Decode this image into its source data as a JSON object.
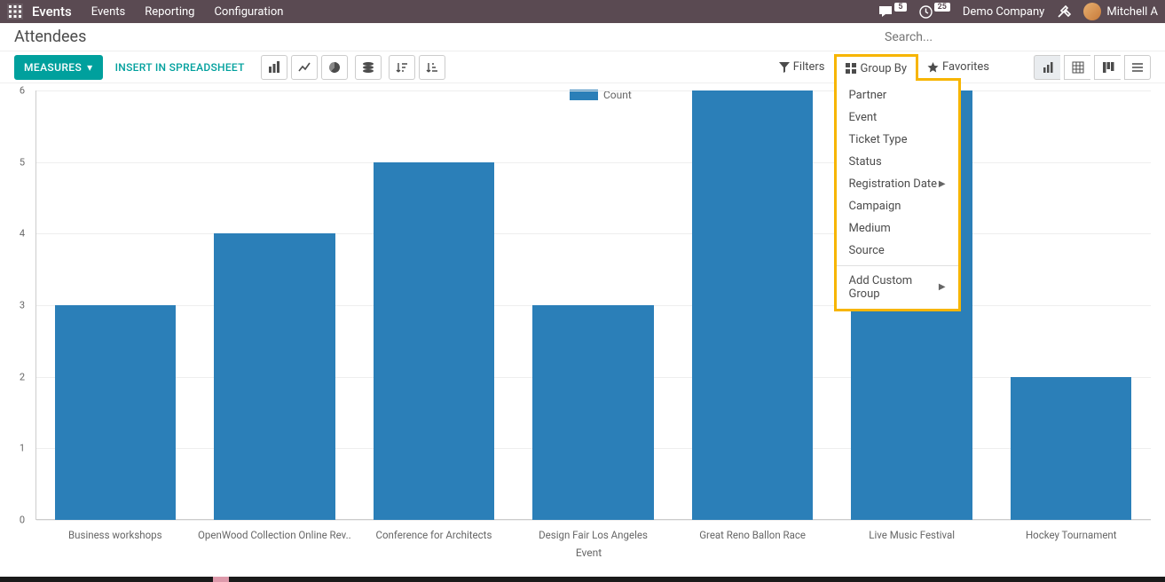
{
  "topnav": {
    "brand": "Events",
    "links": [
      "Events",
      "Reporting",
      "Configuration"
    ],
    "messages_badge": "5",
    "activities_badge": "25",
    "company": "Demo Company",
    "user": "Mitchell A"
  },
  "page": {
    "title": "Attendees",
    "search_placeholder": "Search..."
  },
  "toolbar": {
    "measures": "MEASURES",
    "insert": "INSERT IN SPREADSHEET",
    "filters": "Filters",
    "group_by": "Group By",
    "favorites": "Favorites"
  },
  "groupby_menu": {
    "items": [
      "Partner",
      "Event",
      "Ticket Type",
      "Status",
      "Registration Date",
      "Campaign",
      "Medium",
      "Source"
    ],
    "submenu_index": 4,
    "add_custom": "Add Custom Group"
  },
  "legend": {
    "label": "Count"
  },
  "chart_data": {
    "type": "bar",
    "categories": [
      "Business workshops",
      "OpenWood Collection Online Rev..",
      "Conference for Architects",
      "Design Fair Los Angeles",
      "Great Reno Ballon Race",
      "Live Music Festival",
      "Hockey Tournament"
    ],
    "values": [
      3,
      4,
      5,
      3,
      6,
      6,
      2
    ],
    "xlabel": "Event",
    "ylabel": "",
    "ylim": [
      0,
      6
    ],
    "yticks": [
      0,
      1,
      2,
      3,
      4,
      5,
      6
    ]
  },
  "colors": {
    "bar": "#2b7fb8",
    "highlight": "#f7b500",
    "primary": "#00a09d"
  }
}
